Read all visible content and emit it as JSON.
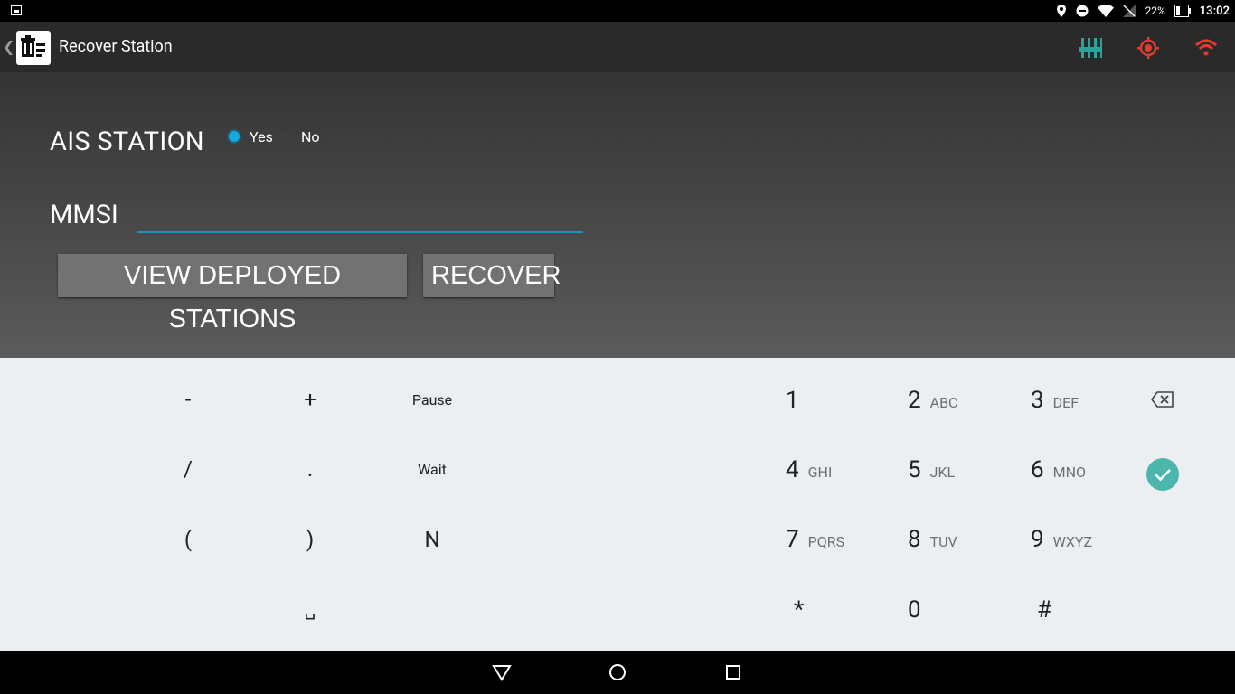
{
  "status_bar": {
    "battery_percent": "22%",
    "time": "13:02",
    "icons": [
      "image-icon",
      "location-icon",
      "do-not-disturb-icon",
      "wifi-icon",
      "no-signal-icon",
      "battery-icon"
    ]
  },
  "app_bar": {
    "title": "Recover Station",
    "actions": [
      "equalizer-icon",
      "location-target-icon",
      "wifi-icon"
    ],
    "action_color": "#e03b30",
    "equalizer_color": "#2aa39a"
  },
  "form": {
    "ais_label": "AIS STATION",
    "radio_yes": "Yes",
    "radio_no": "No",
    "selected": "Yes",
    "mmsi_label": "MMSI",
    "mmsi_value": "",
    "view_button": "VIEW DEPLOYED STATIONS",
    "recover_button": "RECOVER"
  },
  "keypad": {
    "symbols": [
      [
        "-",
        "+",
        "Pause"
      ],
      [
        "/",
        ".",
        "Wait"
      ],
      [
        "(",
        ")",
        "N"
      ],
      [
        "",
        "␣",
        ""
      ]
    ],
    "numbers": [
      [
        {
          "d": "1",
          "l": ""
        },
        {
          "d": "2",
          "l": "ABC"
        },
        {
          "d": "3",
          "l": "DEF"
        }
      ],
      [
        {
          "d": "4",
          "l": "GHI"
        },
        {
          "d": "5",
          "l": "JKL"
        },
        {
          "d": "6",
          "l": "MNO"
        }
      ],
      [
        {
          "d": "7",
          "l": "PQRS"
        },
        {
          "d": "8",
          "l": "TUV"
        },
        {
          "d": "9",
          "l": "WXYZ"
        }
      ],
      [
        {
          "d": "*",
          "l": ""
        },
        {
          "d": "0",
          "l": ""
        },
        {
          "d": "#",
          "l": ""
        }
      ]
    ],
    "accent": "#4db6ac"
  },
  "nav_bar": {
    "icons": [
      "back-icon",
      "home-icon",
      "recents-icon"
    ]
  }
}
